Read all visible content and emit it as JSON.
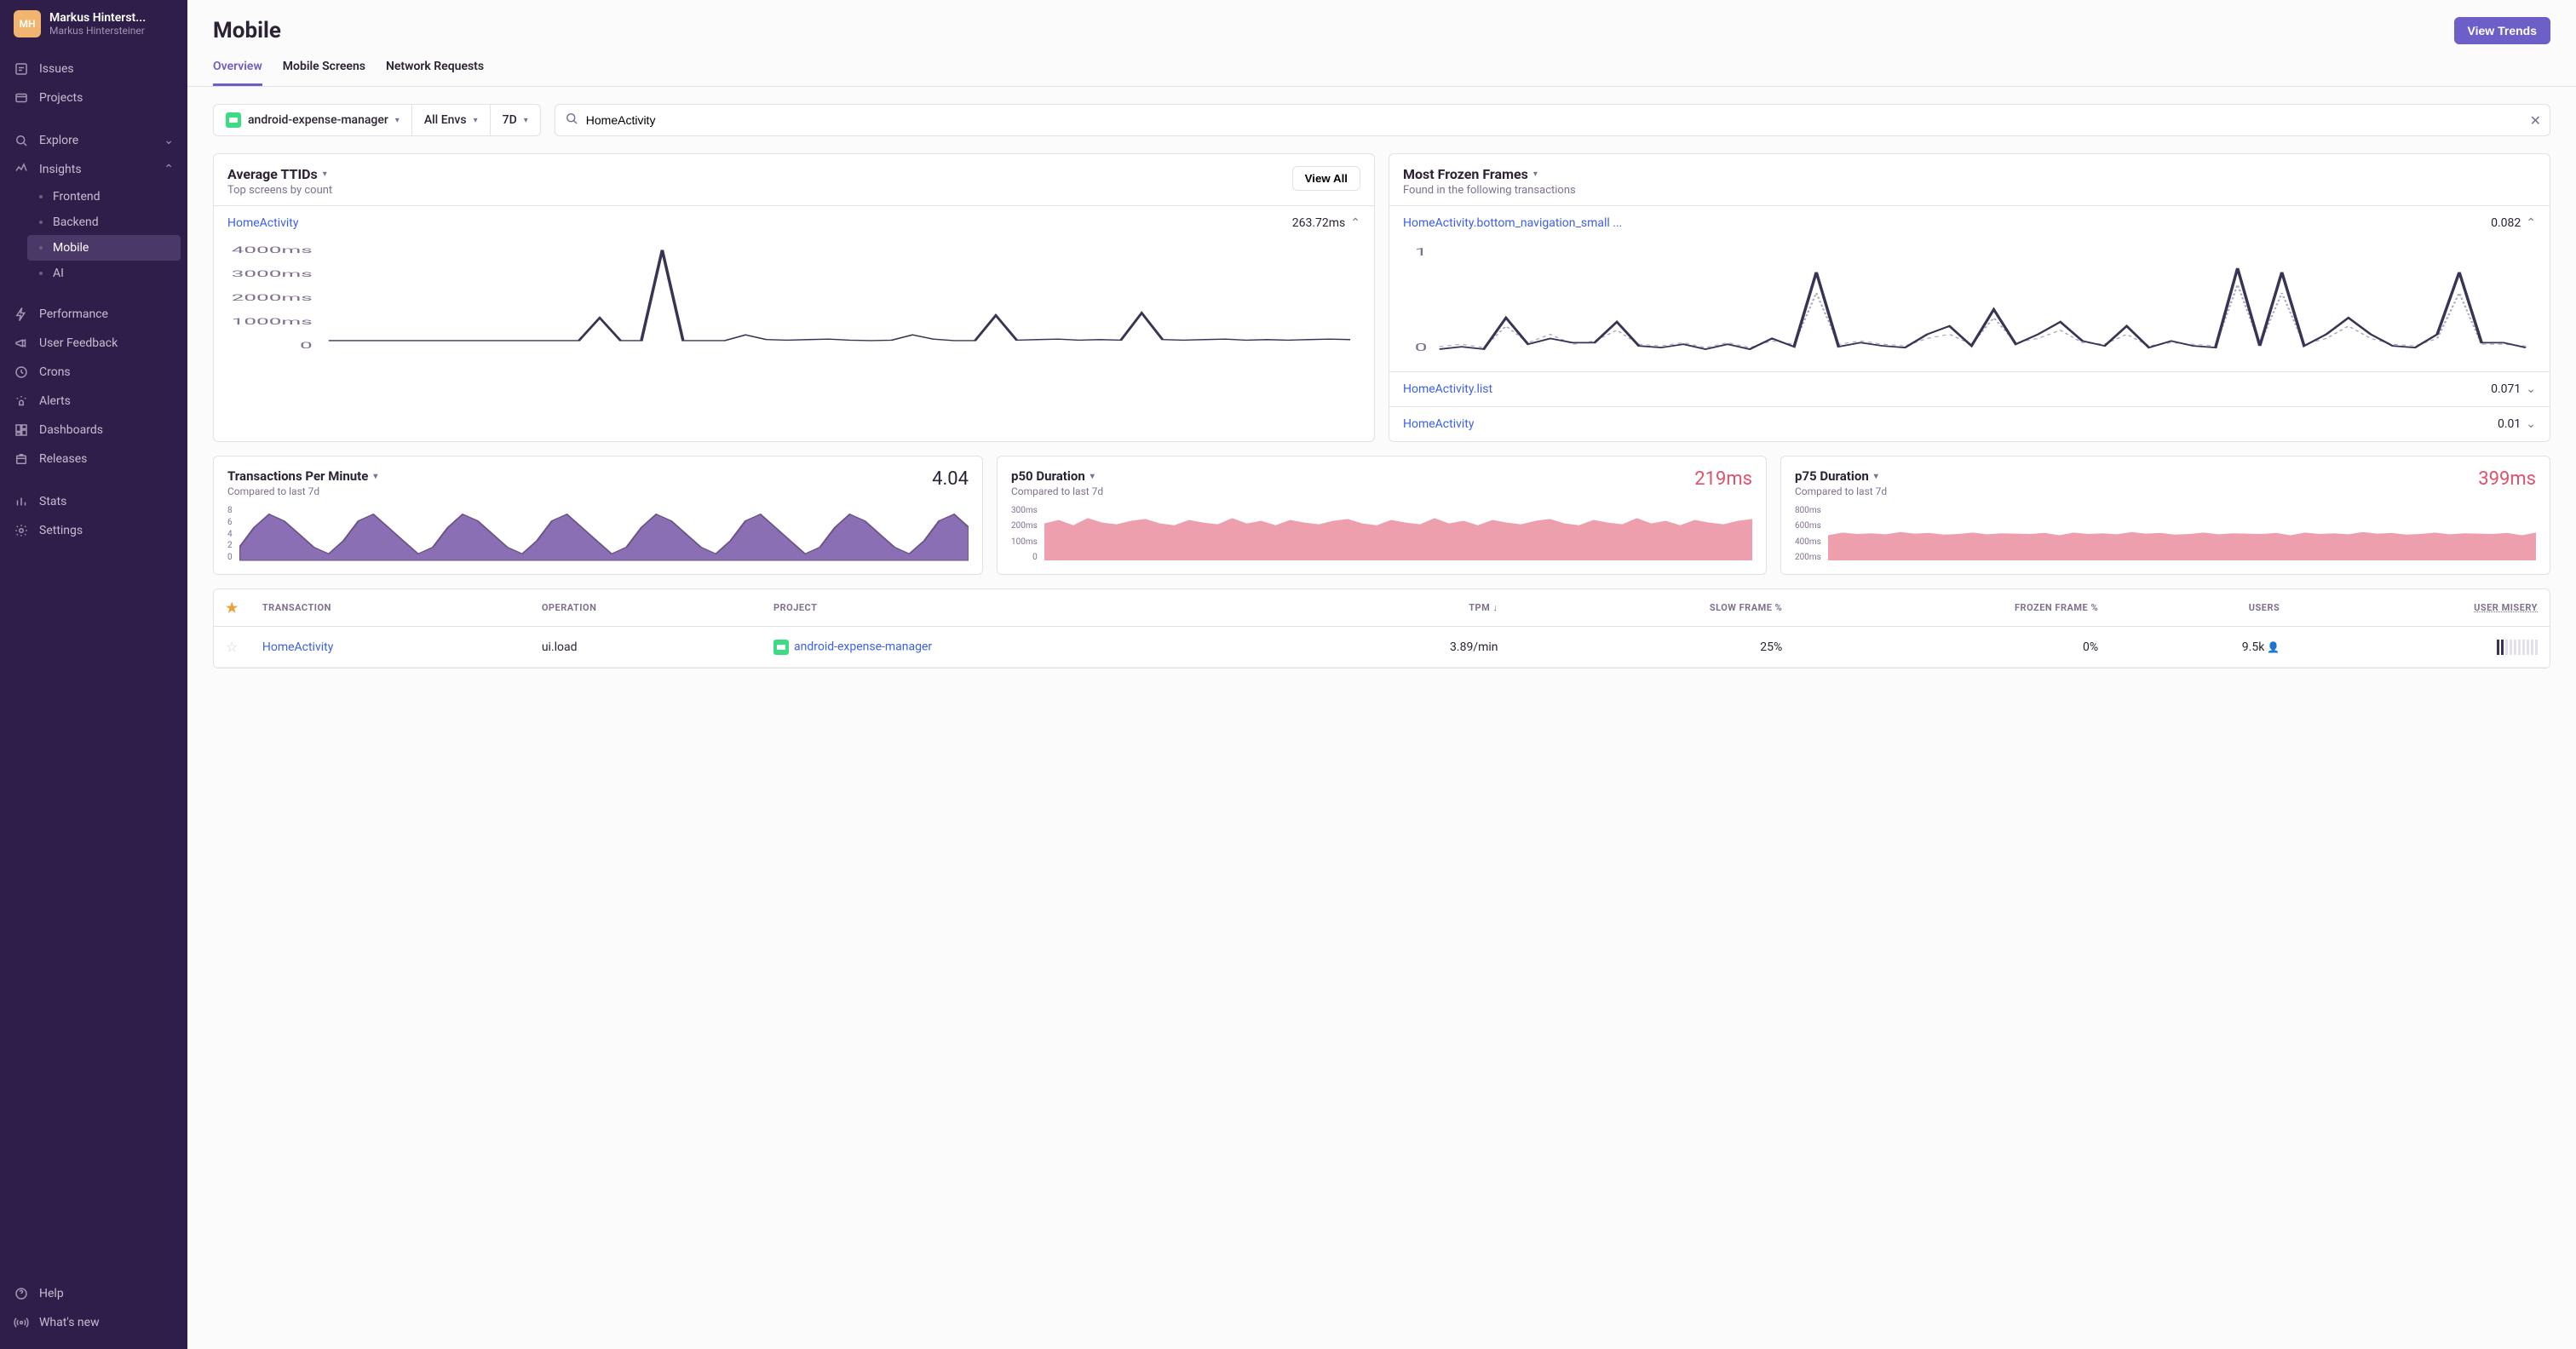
{
  "sidebar": {
    "avatar_initials": "MH",
    "org_name": "Markus Hinterst...",
    "user_name": "Markus Hintersteiner",
    "nav_primary": [
      {
        "label": "Issues",
        "icon": "issues"
      },
      {
        "label": "Projects",
        "icon": "projects"
      }
    ],
    "nav_explore": {
      "label": "Explore"
    },
    "nav_insights": {
      "label": "Insights",
      "items": [
        {
          "label": "Frontend"
        },
        {
          "label": "Backend"
        },
        {
          "label": "Mobile",
          "active": true
        },
        {
          "label": "AI"
        }
      ]
    },
    "nav_secondary": [
      {
        "label": "Performance",
        "icon": "performance"
      },
      {
        "label": "User Feedback",
        "icon": "feedback"
      },
      {
        "label": "Crons",
        "icon": "crons"
      },
      {
        "label": "Alerts",
        "icon": "alerts"
      },
      {
        "label": "Dashboards",
        "icon": "dashboards"
      },
      {
        "label": "Releases",
        "icon": "releases"
      }
    ],
    "nav_tertiary": [
      {
        "label": "Stats",
        "icon": "stats"
      },
      {
        "label": "Settings",
        "icon": "settings"
      }
    ],
    "nav_footer": [
      {
        "label": "Help",
        "icon": "help"
      },
      {
        "label": "What's new",
        "icon": "broadcast"
      }
    ]
  },
  "header": {
    "title": "Mobile",
    "primary_action": "View Trends"
  },
  "tabs": [
    {
      "label": "Overview",
      "active": true
    },
    {
      "label": "Mobile Screens"
    },
    {
      "label": "Network Requests"
    }
  ],
  "filters": {
    "project": "android-expense-manager",
    "env": "All Envs",
    "range": "7D",
    "search_value": "HomeActivity",
    "search_placeholder": "HomeActivity"
  },
  "card_ttid": {
    "title": "Average TTIDs",
    "subtitle": "Top screens by count",
    "view_all": "View All",
    "item_label": "HomeActivity",
    "item_value": "263.72ms",
    "y_ticks": [
      "4000ms",
      "3000ms",
      "2000ms",
      "1000ms",
      "0"
    ]
  },
  "card_frozen": {
    "title": "Most Frozen Frames",
    "subtitle": "Found in the following transactions",
    "rows": [
      {
        "label": "HomeActivity.bottom_navigation_small ...",
        "value": "0.082",
        "expanded": true
      },
      {
        "label": "HomeActivity.list",
        "value": "0.071"
      },
      {
        "label": "HomeActivity",
        "value": "0.01"
      }
    ],
    "y_ticks": [
      "1",
      "0"
    ]
  },
  "stats": [
    {
      "title": "Transactions Per Minute",
      "sub": "Compared to last 7d",
      "value": "4.04",
      "style": "purple",
      "y_ticks": [
        "8",
        "6",
        "4",
        "2",
        "0"
      ]
    },
    {
      "title": "p50 Duration",
      "sub": "Compared to last 7d",
      "value": "219ms",
      "style": "red",
      "y_ticks": [
        "300ms",
        "200ms",
        "100ms",
        "0"
      ]
    },
    {
      "title": "p75 Duration",
      "sub": "Compared to last 7d",
      "value": "399ms",
      "style": "red",
      "y_ticks": [
        "800ms",
        "600ms",
        "400ms",
        "200ms"
      ]
    }
  ],
  "table": {
    "headers": {
      "transaction": "Transaction",
      "operation": "Operation",
      "project": "Project",
      "tpm": "TPM",
      "slow": "Slow Frame %",
      "frozen": "Frozen Frame %",
      "users": "Users",
      "misery": "User Misery"
    },
    "rows": [
      {
        "starred": false,
        "transaction": "HomeActivity",
        "operation": "ui.load",
        "project": "android-expense-manager",
        "tpm": "3.89/min",
        "slow": "25%",
        "frozen": "0%",
        "users": "9.5k",
        "misery_bars": 2
      }
    ]
  },
  "chart_data": [
    {
      "type": "line",
      "title": "Average TTIDs — HomeActivity",
      "ylabel": "ms",
      "ylim": [
        0,
        4000
      ],
      "x": [
        0,
        1,
        2,
        3,
        4,
        5,
        6,
        7,
        8,
        9,
        10,
        11,
        12,
        13,
        14,
        15,
        16,
        17,
        18,
        19,
        20,
        21,
        22,
        23,
        24,
        25,
        26,
        27,
        28,
        29,
        30,
        31,
        32,
        33,
        34,
        35,
        36,
        37,
        38,
        39,
        40,
        41,
        42,
        43,
        44,
        45,
        46,
        47,
        48,
        49
      ],
      "values": [
        260,
        260,
        260,
        260,
        260,
        260,
        260,
        260,
        260,
        260,
        260,
        260,
        260,
        1200,
        260,
        260,
        4000,
        260,
        260,
        260,
        500,
        300,
        280,
        300,
        320,
        280,
        260,
        280,
        500,
        320,
        260,
        260,
        1300,
        280,
        300,
        320,
        280,
        300,
        280,
        1400,
        300,
        280,
        300,
        320,
        280,
        300,
        280,
        300,
        320,
        300
      ]
    },
    {
      "type": "line",
      "title": "Most Frozen Frames — HomeActivity.bottom_navigation_small",
      "ylabel": "count",
      "ylim": [
        0,
        1.2
      ],
      "series": [
        {
          "name": "current",
          "values": [
            0.02,
            0.05,
            0.02,
            0.4,
            0.08,
            0.15,
            0.1,
            0.1,
            0.35,
            0.06,
            0.04,
            0.08,
            0.02,
            0.08,
            0.02,
            0.15,
            0.05,
            0.95,
            0.05,
            0.1,
            0.06,
            0.04,
            0.2,
            0.3,
            0.06,
            0.5,
            0.08,
            0.2,
            0.35,
            0.12,
            0.06,
            0.3,
            0.04,
            0.12,
            0.06,
            0.04,
            1.0,
            0.06,
            0.95,
            0.06,
            0.2,
            0.4,
            0.2,
            0.06,
            0.04,
            0.2,
            0.95,
            0.1,
            0.1,
            0.04
          ]
        },
        {
          "name": "previous",
          "values": [
            0.05,
            0.08,
            0.04,
            0.3,
            0.1,
            0.2,
            0.08,
            0.12,
            0.25,
            0.08,
            0.06,
            0.1,
            0.04,
            0.1,
            0.04,
            0.12,
            0.08,
            0.7,
            0.08,
            0.12,
            0.08,
            0.06,
            0.15,
            0.2,
            0.08,
            0.4,
            0.1,
            0.15,
            0.25,
            0.1,
            0.08,
            0.2,
            0.06,
            0.1,
            0.08,
            0.06,
            0.8,
            0.08,
            0.7,
            0.08,
            0.15,
            0.3,
            0.15,
            0.08,
            0.06,
            0.15,
            0.7,
            0.08,
            0.08,
            0.06
          ]
        }
      ]
    },
    {
      "type": "area",
      "title": "Transactions Per Minute",
      "ylim": [
        0,
        8
      ],
      "values": [
        2,
        5,
        7,
        6,
        4,
        2,
        1,
        3,
        6,
        7,
        5,
        3,
        1,
        2,
        5,
        7,
        6,
        4,
        2,
        1,
        3,
        6,
        7,
        5,
        3,
        1,
        2,
        5,
        7,
        6,
        4,
        2,
        1,
        3,
        6,
        7,
        5,
        3,
        1,
        2,
        5,
        7,
        6,
        4,
        2,
        1,
        3,
        6,
        7,
        5
      ]
    },
    {
      "type": "area",
      "title": "p50 Duration",
      "ylabel": "ms",
      "ylim": [
        0,
        300
      ],
      "values": [
        210,
        230,
        200,
        240,
        215,
        205,
        225,
        235,
        210,
        200,
        230,
        215,
        205,
        240,
        210,
        225,
        200,
        230,
        215,
        205,
        225,
        235,
        210,
        200,
        230,
        215,
        205,
        240,
        210,
        225,
        200,
        230,
        215,
        205,
        225,
        235,
        210,
        200,
        230,
        215,
        205,
        240,
        210,
        225,
        200,
        230,
        215,
        205,
        225,
        235
      ]
    },
    {
      "type": "area",
      "title": "p75 Duration",
      "ylabel": "ms",
      "ylim": [
        0,
        800
      ],
      "values": [
        380,
        420,
        400,
        410,
        395,
        430,
        405,
        415,
        390,
        400,
        420,
        395,
        410,
        405,
        400,
        415,
        380,
        420,
        400,
        410,
        395,
        430,
        405,
        415,
        390,
        400,
        420,
        395,
        410,
        405,
        400,
        415,
        380,
        420,
        400,
        410,
        395,
        430,
        405,
        415,
        390,
        400,
        420,
        395,
        410,
        405,
        400,
        415,
        380,
        420
      ]
    }
  ]
}
